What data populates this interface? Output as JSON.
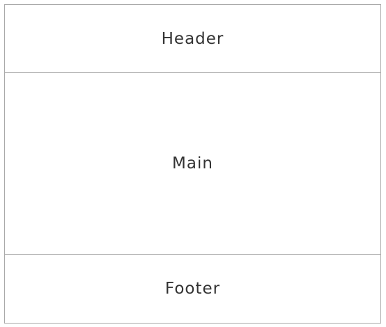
{
  "layout": {
    "header": "Header",
    "main": "Main",
    "footer": "Footer"
  }
}
